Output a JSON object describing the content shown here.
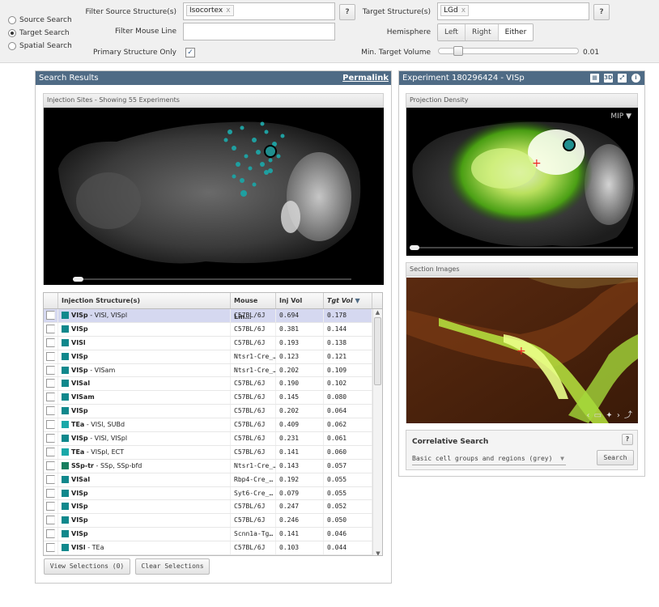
{
  "search_modes": [
    {
      "label": "Source Search",
      "selected": false
    },
    {
      "label": "Target Search",
      "selected": true
    },
    {
      "label": "Spatial Search",
      "selected": false
    }
  ],
  "filters": {
    "source_label": "Filter Source Structure(s)",
    "source_token": "Isocortex",
    "mouse_line_label": "Filter Mouse Line",
    "primary_only_label": "Primary Structure Only",
    "target_label": "Target Structure(s)",
    "target_token": "LGd",
    "hemisphere_label": "Hemisphere",
    "hemisphere_options": [
      "Left",
      "Right",
      "Either"
    ],
    "hemisphere_selected": "Either",
    "min_target_label": "Min. Target Volume",
    "min_target_value": "0.01",
    "help": "?"
  },
  "results": {
    "title": "Search Results",
    "permalink": "Permalink",
    "injection_sites_title": "Injection Sites - Showing 55 Experiments",
    "columns": [
      "Injection Structure(s)",
      "Mouse Lin…",
      "Inj Vol",
      "Tgt Vol"
    ],
    "rows": [
      {
        "abbr": "VISp",
        "rest": " - VISl, VISpl",
        "line": "C57BL/6J",
        "inj": "0.694",
        "tgt": "0.178",
        "color": "#10888c",
        "selected": true
      },
      {
        "abbr": "VISp",
        "rest": "",
        "line": "C57BL/6J",
        "inj": "0.381",
        "tgt": "0.144",
        "color": "#10888c"
      },
      {
        "abbr": "VISl",
        "rest": "",
        "line": "C57BL/6J",
        "inj": "0.193",
        "tgt": "0.138",
        "color": "#10888c"
      },
      {
        "abbr": "VISp",
        "rest": "",
        "line": "Ntsr1-Cre_…",
        "inj": "0.123",
        "tgt": "0.121",
        "color": "#10888c"
      },
      {
        "abbr": "VISp",
        "rest": " - VISam",
        "line": "Ntsr1-Cre_…",
        "inj": "0.202",
        "tgt": "0.109",
        "color": "#10888c"
      },
      {
        "abbr": "VISal",
        "rest": "",
        "line": "C57BL/6J",
        "inj": "0.190",
        "tgt": "0.102",
        "color": "#10888c"
      },
      {
        "abbr": "VISam",
        "rest": "",
        "line": "C57BL/6J",
        "inj": "0.145",
        "tgt": "0.080",
        "color": "#10888c"
      },
      {
        "abbr": "VISp",
        "rest": "",
        "line": "C57BL/6J",
        "inj": "0.202",
        "tgt": "0.064",
        "color": "#10888c"
      },
      {
        "abbr": "TEa",
        "rest": " - VISl, SUBd",
        "line": "C57BL/6J",
        "inj": "0.409",
        "tgt": "0.062",
        "color": "#19a8a8"
      },
      {
        "abbr": "VISp",
        "rest": " - VISl, VISpl",
        "line": "C57BL/6J",
        "inj": "0.231",
        "tgt": "0.061",
        "color": "#10888c"
      },
      {
        "abbr": "TEa",
        "rest": " - VISpl, ECT",
        "line": "C57BL/6J",
        "inj": "0.141",
        "tgt": "0.060",
        "color": "#19a8a8"
      },
      {
        "abbr": "SSp-tr",
        "rest": " - SSp, SSp-bfd",
        "line": "Ntsr1-Cre_…",
        "inj": "0.143",
        "tgt": "0.057",
        "color": "#187e5f"
      },
      {
        "abbr": "VISal",
        "rest": "",
        "line": "Rbp4-Cre_…",
        "inj": "0.192",
        "tgt": "0.055",
        "color": "#10888c"
      },
      {
        "abbr": "VISp",
        "rest": "",
        "line": "Syt6-Cre_…",
        "inj": "0.079",
        "tgt": "0.055",
        "color": "#10888c"
      },
      {
        "abbr": "VISp",
        "rest": "",
        "line": "C57BL/6J",
        "inj": "0.247",
        "tgt": "0.052",
        "color": "#10888c"
      },
      {
        "abbr": "VISp",
        "rest": "",
        "line": "C57BL/6J",
        "inj": "0.246",
        "tgt": "0.050",
        "color": "#10888c"
      },
      {
        "abbr": "VISp",
        "rest": "",
        "line": "Scnn1a-Tg…",
        "inj": "0.141",
        "tgt": "0.046",
        "color": "#10888c"
      },
      {
        "abbr": "VISl",
        "rest": " - TEa",
        "line": "C57BL/6J",
        "inj": "0.103",
        "tgt": "0.044",
        "color": "#10888c"
      }
    ],
    "view_selections": "View Selections (0)",
    "clear_selections": "Clear Selections"
  },
  "experiment": {
    "title": "Experiment 180296424 - VISp",
    "projection_title": "Projection Density",
    "mip_label": "MIP ▼",
    "section_title": "Section Images",
    "correlative_title": "Correlative Search",
    "correlative_select": "Basic cell groups and regions (grey)",
    "search_button": "Search",
    "help": "?"
  }
}
